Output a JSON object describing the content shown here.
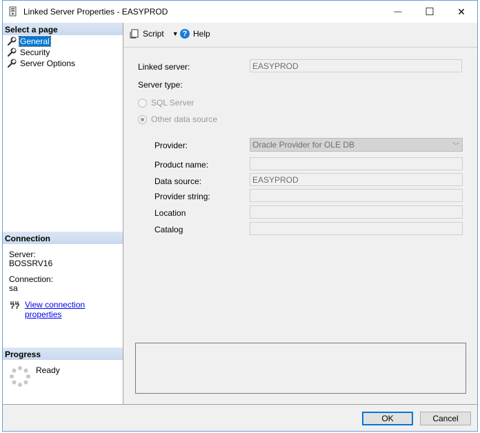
{
  "window": {
    "title": "Linked Server Properties - EASYPROD",
    "minimize_glyph": "—",
    "maximize_glyph": "☐",
    "close_glyph": "✕"
  },
  "left": {
    "select_page_header": "Select a page",
    "pages": [
      {
        "label": "General",
        "icon": "wrench-icon",
        "selected": true
      },
      {
        "label": "Security",
        "icon": "wrench-icon",
        "selected": false
      },
      {
        "label": "Server Options",
        "icon": "wrench-icon",
        "selected": false
      }
    ],
    "connection_header": "Connection",
    "server_label": "Server:",
    "server_value": "BOSSRV16",
    "connection_label": "Connection:",
    "connection_value": "sa",
    "view_props_link": "View connection properties",
    "progress_header": "Progress",
    "progress_status": "Ready"
  },
  "toolbar": {
    "script_label": "Script",
    "help_label": "Help"
  },
  "form": {
    "linked_server_label": "Linked server:",
    "linked_server_value": "EASYPROD",
    "server_type_label": "Server type:",
    "sql_server_option": "SQL Server",
    "other_source_option": "Other data source",
    "provider_label": "Provider:",
    "provider_value": "Oracle Provider for OLE DB",
    "product_name_label": "Product name:",
    "product_name_value": "",
    "data_source_label": "Data source:",
    "data_source_value": "EASYPROD",
    "provider_string_label": "Provider string:",
    "provider_string_value": "",
    "location_label": "Location",
    "location_value": "",
    "catalog_label": "Catalog",
    "catalog_value": ""
  },
  "buttons": {
    "ok": "OK",
    "cancel": "Cancel"
  },
  "colors": {
    "selection": "#0078d7",
    "link": "#0000ee",
    "header_gradient": "#c9d9ee"
  }
}
